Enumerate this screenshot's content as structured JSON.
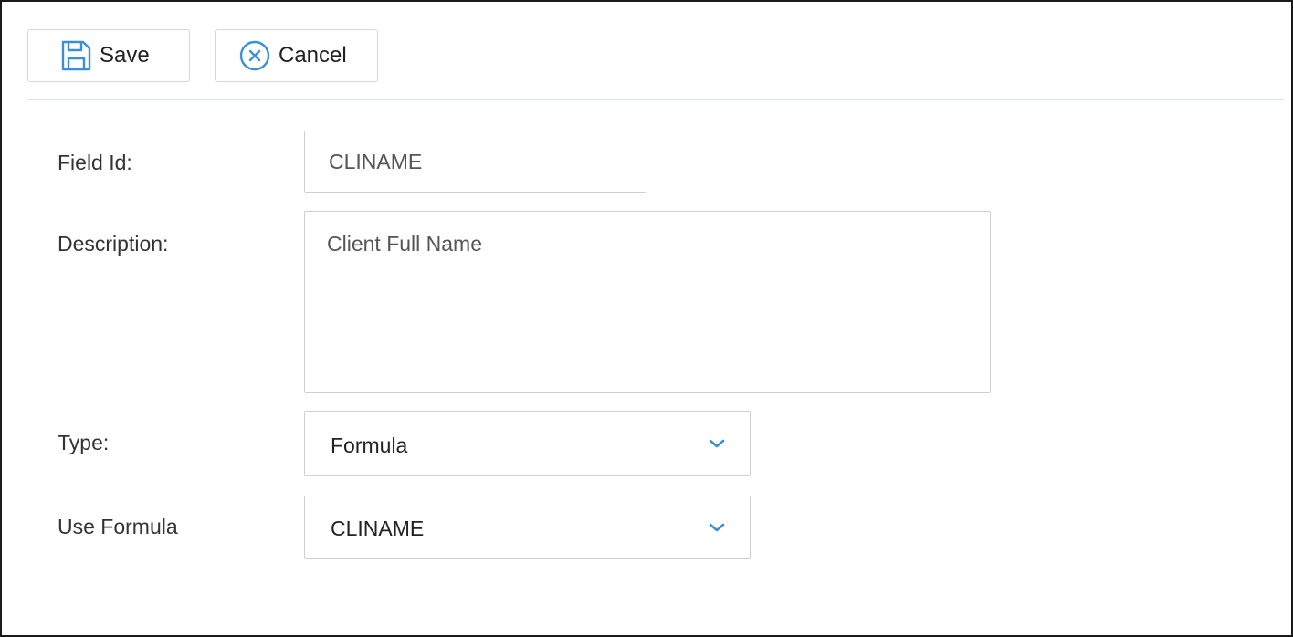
{
  "toolbar": {
    "save_label": "Save",
    "cancel_label": "Cancel",
    "save_icon": "save-floppy-icon",
    "cancel_icon": "circle-x-icon"
  },
  "form": {
    "field_id": {
      "label": "Field Id:",
      "value": "CLINAME"
    },
    "description": {
      "label": "Description:",
      "value": "Client Full Name"
    },
    "type": {
      "label": "Type:",
      "value": "Formula"
    },
    "use_formula": {
      "label": "Use Formula",
      "value": "CLINAME"
    }
  },
  "colors": {
    "accent": "#3b8fd6",
    "border": "#cfcfcf",
    "separator": "#d9e7f1"
  }
}
